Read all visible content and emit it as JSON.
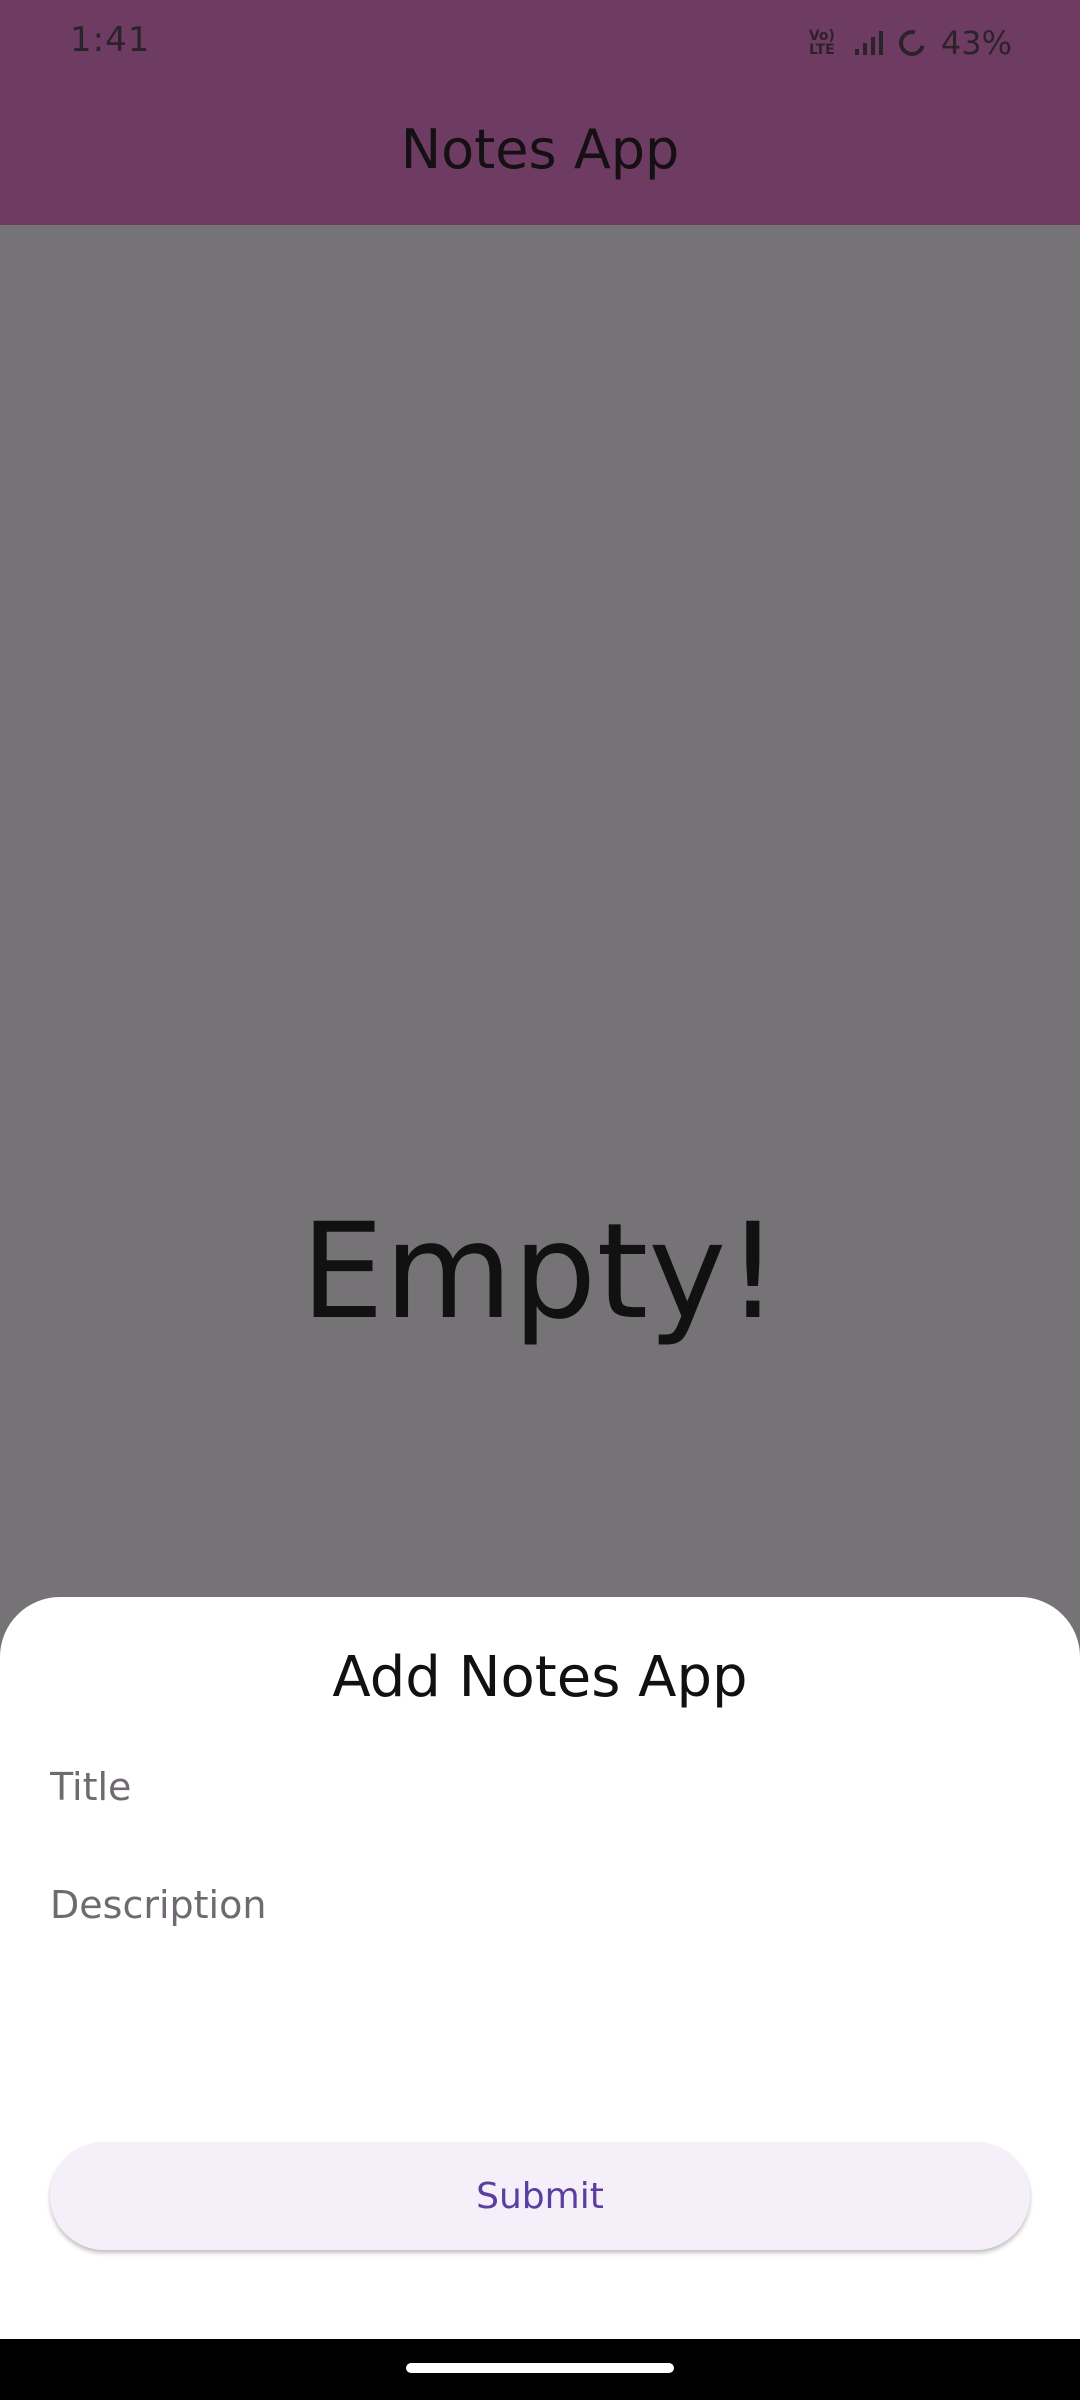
{
  "status_bar": {
    "time": "1:41",
    "volte_label": "Vo) LTE",
    "battery": "43%"
  },
  "app_bar": {
    "title": "Notes App"
  },
  "main": {
    "empty_message": "Empty!"
  },
  "bottom_sheet": {
    "title": "Add Notes App",
    "title_placeholder": "Title",
    "description_placeholder": "Description",
    "submit_label": "Submit"
  },
  "colors": {
    "app_bar": "#6e3b62",
    "scrim_background": "#757376",
    "sheet_background": "#ffffff",
    "button_background": "#f4eff8",
    "button_text": "#5b3ea0"
  },
  "icons": [
    "volte-icon",
    "signal-icon",
    "battery-icon"
  ]
}
